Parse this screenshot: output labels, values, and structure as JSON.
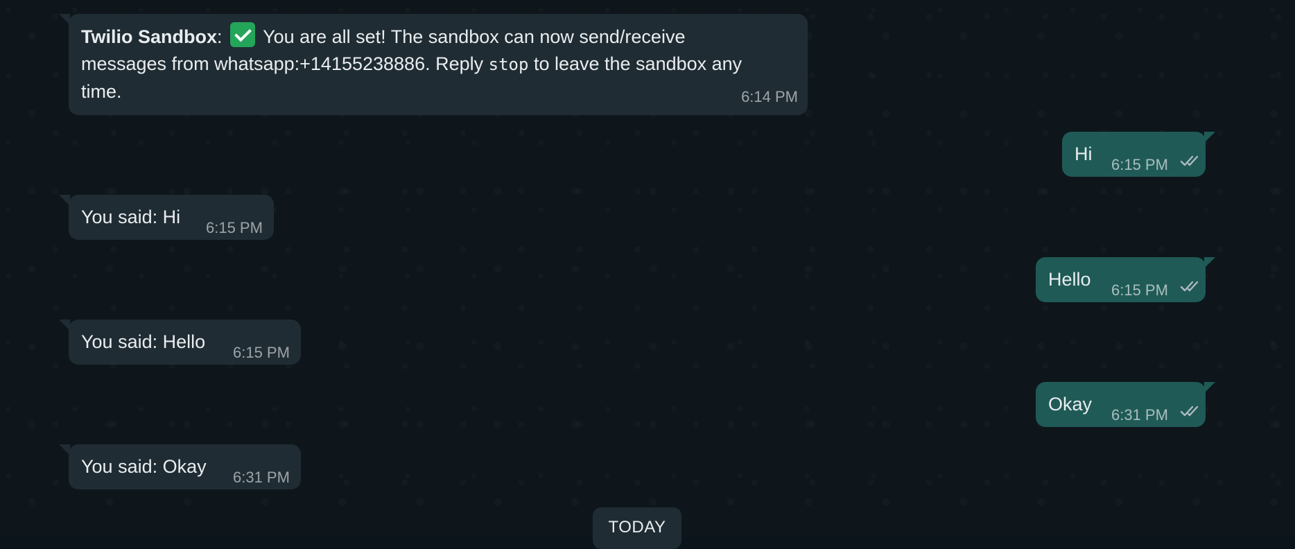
{
  "chat": {
    "messages": [
      {
        "direction": "incoming",
        "sender": "Twilio Sandbox",
        "separator": ":",
        "icon": "check-mark-button-icon",
        "line1": "You are all set! The sandbox can now send/receive",
        "line2": "messages from whatsapp:+14155238886. Reply",
        "code": "stop",
        "line2_end": "to leave the sandbox any",
        "line3": "time.",
        "time": "6:14 PM"
      },
      {
        "direction": "outgoing",
        "text": "Hi",
        "time": "6:15 PM",
        "status": "read-double-check-icon"
      },
      {
        "direction": "incoming",
        "text": "You said: Hi",
        "time": "6:15 PM"
      },
      {
        "direction": "outgoing",
        "text": "Hello",
        "time": "6:15 PM",
        "status": "read-double-check-icon"
      },
      {
        "direction": "incoming",
        "text": "You said: Hello",
        "time": "6:15 PM"
      },
      {
        "direction": "outgoing",
        "text": "Okay",
        "time": "6:31 PM",
        "status": "read-double-check-icon"
      },
      {
        "direction": "incoming",
        "text": "You said: Okay",
        "time": "6:31 PM"
      }
    ],
    "date_divider": "TODAY"
  },
  "colors": {
    "background": "#0b141a",
    "incoming_bubble": "#202c33",
    "outgoing_bubble": "#1f5a56",
    "text": "#e9edef",
    "check_icon": "#23a55a"
  }
}
